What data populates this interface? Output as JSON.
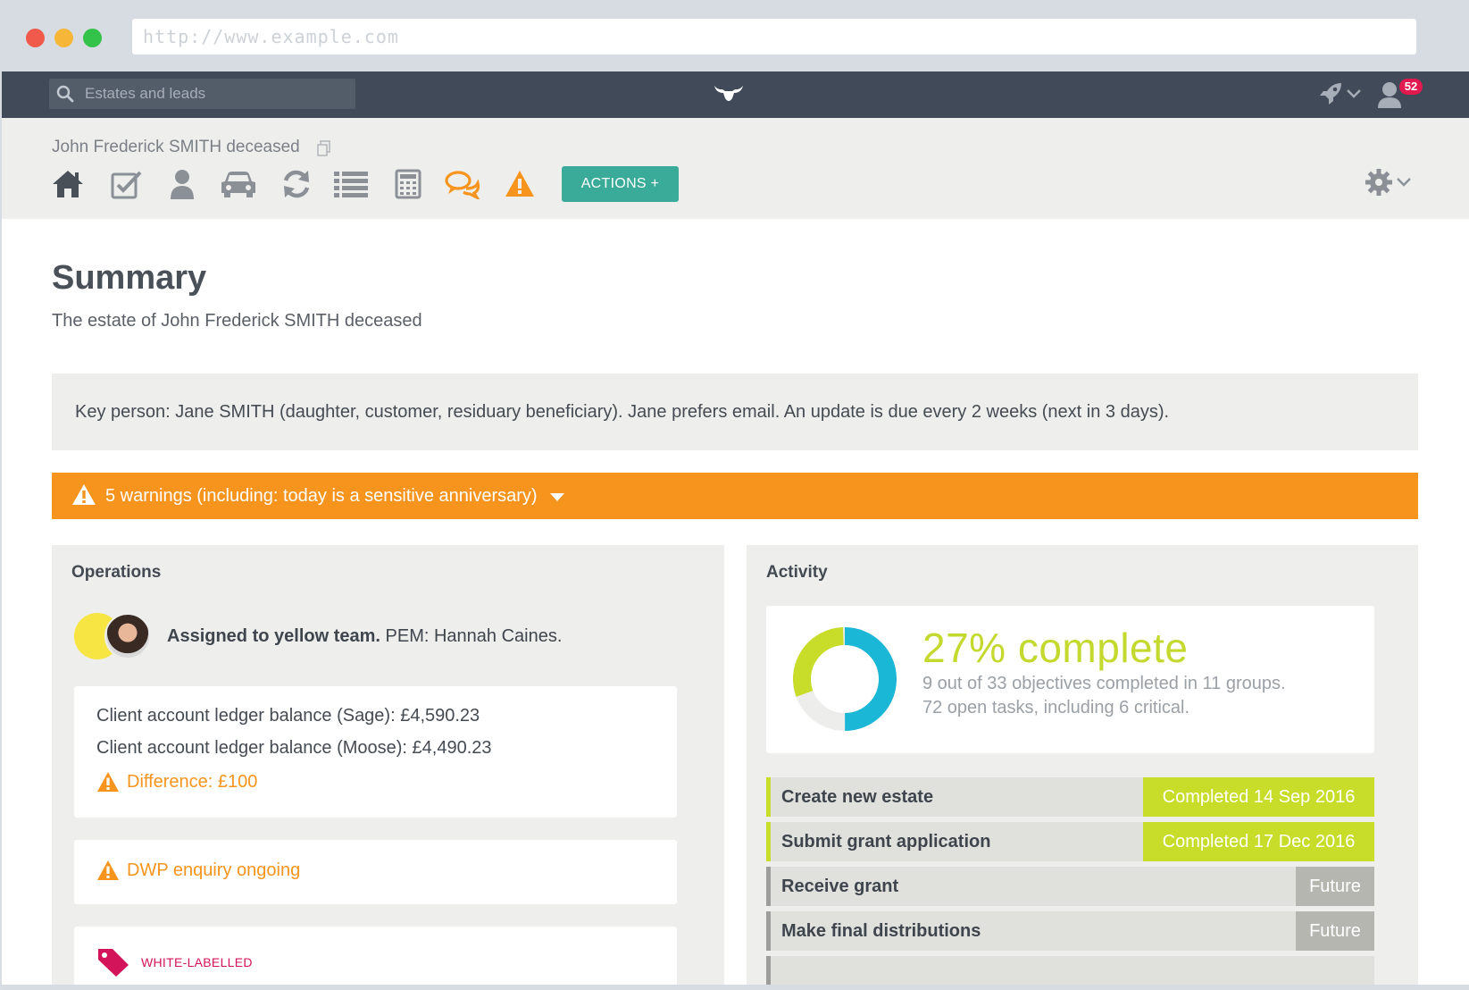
{
  "browser": {
    "url": "http://www.example.com"
  },
  "nav": {
    "search_placeholder": "Estates and leads",
    "notification_count": "52"
  },
  "estate": {
    "name": "John Frederick SMITH deceased",
    "actions_label": "ACTIONS +"
  },
  "toolbar_icons": [
    "home-icon",
    "checklist-icon",
    "person-icon",
    "car-icon",
    "refresh-icon",
    "list-icon",
    "calculator-icon",
    "chat-icon",
    "warning-icon"
  ],
  "summary": {
    "title": "Summary",
    "subtitle": "The estate of John Frederick SMITH deceased",
    "key_person": "Key person: Jane SMITH (daughter, customer, residuary beneficiary). Jane prefers email. An update is due every 2 weeks (next in 3 days).",
    "warnings": "5 warnings (including: today is a sensitive anniversary)"
  },
  "operations": {
    "title": "Operations",
    "team_bold": "Assigned to yellow team.",
    "team_rest": "PEM: Hannah Caines.",
    "ledger_sage": "Client account ledger balance (Sage): £4,590.23",
    "ledger_moose": "Client account ledger balance (Moose): £4,490.23",
    "difference": "Difference: £100",
    "dwp": "DWP enquiry ongoing",
    "tag": "WHITE-LABELLED"
  },
  "activity": {
    "title": "Activity",
    "progress_title": "27% complete",
    "progress_fraction": 0.27,
    "progress_line1": "9 out of 33 objectives completed in 11 groups.",
    "progress_line2": "72 open tasks, including 6 critical.",
    "milestones": [
      {
        "label": "Create new estate",
        "status": "Completed 14 Sep 2016",
        "state": "done"
      },
      {
        "label": "Submit grant application",
        "status": "Completed 17 Dec 2016",
        "state": "done"
      },
      {
        "label": "Receive grant",
        "status": "Future",
        "state": "future"
      },
      {
        "label": "Make final distributions",
        "status": "Future",
        "state": "future"
      }
    ]
  },
  "colors": {
    "nav_bg": "#414a58",
    "accent_teal": "#3bab99",
    "warning_orange": "#f7941d",
    "progress_lime": "#c8dc2a",
    "progress_cyan": "#1ab7d6",
    "tag_pink": "#d4145a"
  }
}
